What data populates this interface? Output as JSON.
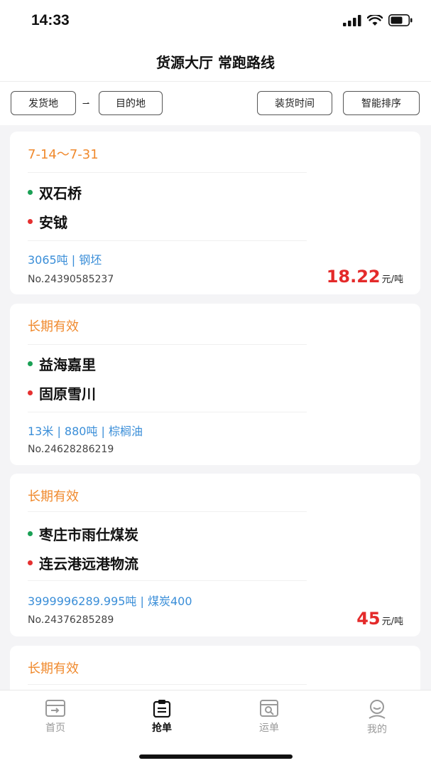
{
  "status": {
    "time": "14:33"
  },
  "header": {
    "title": "货源大厅 常跑路线"
  },
  "filters": {
    "origin": "发货地",
    "destination": "目的地",
    "load_time": "装货时间",
    "smart_sort": "智能排序"
  },
  "cards": [
    {
      "date": "7-14～7-31",
      "from": "双石桥",
      "to": "安钺",
      "spec": "3065吨 | 钢坯",
      "no": "No.24390585237",
      "price": "18.22",
      "unit": "元/吨"
    },
    {
      "date": "长期有效",
      "from": "益海嘉里",
      "to": "固原雪川",
      "spec": "13米 | 880吨 | 棕榈油",
      "no": "No.24628286219"
    },
    {
      "date": "长期有效",
      "from": "枣庄市雨仕煤炭",
      "to": "连云港远港物流",
      "spec": "3999996289.995吨 | 煤炭400",
      "no": "No.24376285289",
      "price": "45",
      "unit": "元/吨"
    },
    {
      "date": "长期有效"
    }
  ],
  "tabs": [
    {
      "label": "首页",
      "icon": "home-icon",
      "active": false
    },
    {
      "label": "抢单",
      "icon": "clipboard-icon",
      "active": true
    },
    {
      "label": "运单",
      "icon": "waybill-icon",
      "active": false
    },
    {
      "label": "我的",
      "icon": "profile-icon",
      "active": false
    }
  ],
  "colors": {
    "accent_orange": "#f08a2e",
    "price_red": "#e42a2a",
    "link_blue": "#3a8ed8",
    "origin_dot": "#1aa055",
    "dest_dot": "#e53030"
  }
}
